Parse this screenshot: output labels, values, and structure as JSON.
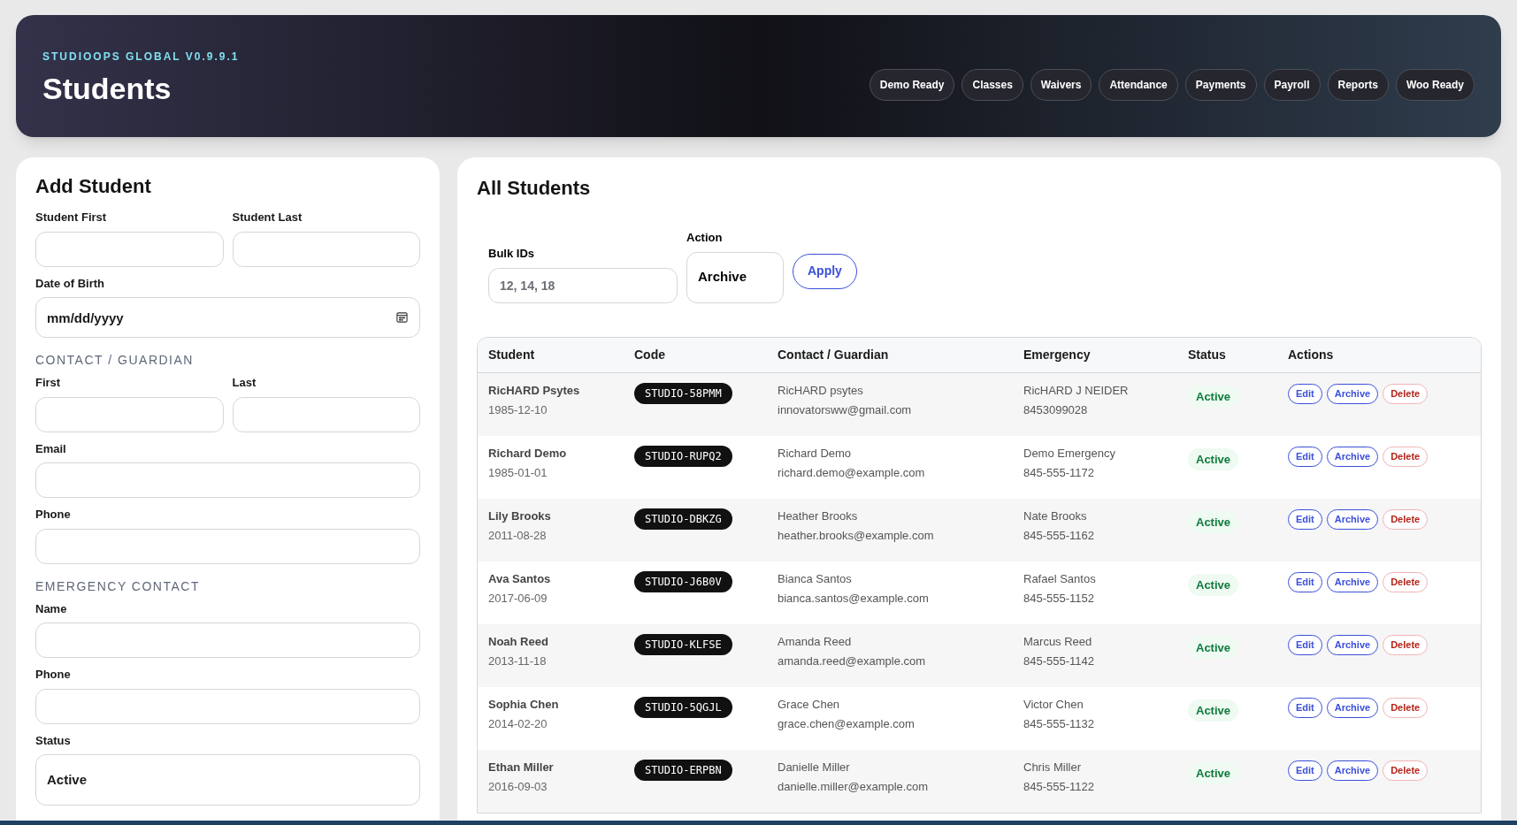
{
  "header": {
    "brand": "STUDIOOPS GLOBAL V0.9.9.1",
    "title": "Students",
    "nav": [
      {
        "label": "Demo Ready"
      },
      {
        "label": "Classes"
      },
      {
        "label": "Waivers"
      },
      {
        "label": "Attendance"
      },
      {
        "label": "Payments"
      },
      {
        "label": "Payroll"
      },
      {
        "label": "Reports"
      },
      {
        "label": "Woo Ready"
      }
    ]
  },
  "add_student": {
    "title": "Add Student",
    "items": [
      {
        "kind": "row",
        "fields": [
          {
            "label": "Student First",
            "kind": "text"
          },
          {
            "label": "Student Last",
            "kind": "text"
          }
        ]
      },
      {
        "kind": "row",
        "fields": [
          {
            "label": "Date of Birth",
            "kind": "date",
            "placeholder": "mm/dd/yyyy"
          }
        ]
      },
      {
        "kind": "heading",
        "text": "CONTACT / GUARDIAN"
      },
      {
        "kind": "row",
        "fields": [
          {
            "label": "First",
            "kind": "text"
          },
          {
            "label": "Last",
            "kind": "text"
          }
        ]
      },
      {
        "kind": "row",
        "fields": [
          {
            "label": "Email",
            "kind": "text"
          }
        ]
      },
      {
        "kind": "row",
        "fields": [
          {
            "label": "Phone",
            "kind": "text"
          }
        ]
      },
      {
        "kind": "heading",
        "text": "EMERGENCY CONTACT"
      },
      {
        "kind": "row",
        "fields": [
          {
            "label": "Name",
            "kind": "text"
          }
        ]
      },
      {
        "kind": "row",
        "fields": [
          {
            "label": "Phone",
            "kind": "text"
          }
        ]
      },
      {
        "kind": "row",
        "fields": [
          {
            "label": "Status",
            "kind": "select",
            "value": "Active"
          }
        ]
      }
    ]
  },
  "all_students": {
    "title": "All Students",
    "bulk": {
      "ids_label": "Bulk IDs",
      "ids_placeholder": "12, 14, 18",
      "action_label": "Action",
      "action_value": "Archive",
      "apply": "Apply"
    },
    "table": {
      "columns": [
        "Student",
        "Code",
        "Contact / Guardian",
        "Emergency",
        "Status",
        "Actions"
      ],
      "rows": [
        {
          "name": "RicHARD Psytes",
          "dob": "1985-12-10",
          "code": "STUDIO-58PMM",
          "contact": "RicHARD psytes",
          "contact_email": "innovatorsww@gmail.com",
          "emergency": "RicHARD J NEIDER",
          "emergency_phone": "8453099028",
          "status": "Active",
          "actions": [
            {
              "label": "Edit",
              "kind": "edit"
            },
            {
              "label": "Archive",
              "kind": "archive"
            },
            {
              "label": "Delete",
              "kind": "delete"
            }
          ]
        },
        {
          "name": "Richard Demo",
          "dob": "1985-01-01",
          "code": "STUDIO-RUPQ2",
          "contact": "Richard Demo",
          "contact_email": "richard.demo@example.com",
          "emergency": "Demo Emergency",
          "emergency_phone": "845-555-1172",
          "status": "Active",
          "actions": [
            {
              "label": "Edit",
              "kind": "edit"
            },
            {
              "label": "Archive",
              "kind": "archive"
            },
            {
              "label": "Delete",
              "kind": "delete"
            }
          ]
        },
        {
          "name": "Lily Brooks",
          "dob": "2011-08-28",
          "code": "STUDIO-DBKZG",
          "contact": "Heather Brooks",
          "contact_email": "heather.brooks@example.com",
          "emergency": "Nate Brooks",
          "emergency_phone": "845-555-1162",
          "status": "Active",
          "actions": [
            {
              "label": "Edit",
              "kind": "edit"
            },
            {
              "label": "Archive",
              "kind": "archive"
            },
            {
              "label": "Delete",
              "kind": "delete"
            }
          ]
        },
        {
          "name": "Ava Santos",
          "dob": "2017-06-09",
          "code": "STUDIO-J6B0V",
          "contact": "Bianca Santos",
          "contact_email": "bianca.santos@example.com",
          "emergency": "Rafael Santos",
          "emergency_phone": "845-555-1152",
          "status": "Active",
          "actions": [
            {
              "label": "Edit",
              "kind": "edit"
            },
            {
              "label": "Archive",
              "kind": "archive"
            },
            {
              "label": "Delete",
              "kind": "delete"
            }
          ]
        },
        {
          "name": "Noah Reed",
          "dob": "2013-11-18",
          "code": "STUDIO-KLFSE",
          "contact": "Amanda Reed",
          "contact_email": "amanda.reed@example.com",
          "emergency": "Marcus Reed",
          "emergency_phone": "845-555-1142",
          "status": "Active",
          "actions": [
            {
              "label": "Edit",
              "kind": "edit"
            },
            {
              "label": "Archive",
              "kind": "archive"
            },
            {
              "label": "Delete",
              "kind": "delete"
            }
          ]
        },
        {
          "name": "Sophia Chen",
          "dob": "2014-02-20",
          "code": "STUDIO-5QGJL",
          "contact": "Grace Chen",
          "contact_email": "grace.chen@example.com",
          "emergency": "Victor Chen",
          "emergency_phone": "845-555-1132",
          "status": "Active",
          "actions": [
            {
              "label": "Edit",
              "kind": "edit"
            },
            {
              "label": "Archive",
              "kind": "archive"
            },
            {
              "label": "Delete",
              "kind": "delete"
            }
          ]
        },
        {
          "name": "Ethan Miller",
          "dob": "2016-09-03",
          "code": "STUDIO-ERPBN",
          "contact": "Danielle Miller",
          "contact_email": "danielle.miller@example.com",
          "emergency": "Chris Miller",
          "emergency_phone": "845-555-1122",
          "status": "Active",
          "actions": [
            {
              "label": "Edit",
              "kind": "edit"
            },
            {
              "label": "Archive",
              "kind": "archive"
            },
            {
              "label": "Delete",
              "kind": "delete"
            }
          ]
        }
      ]
    }
  }
}
